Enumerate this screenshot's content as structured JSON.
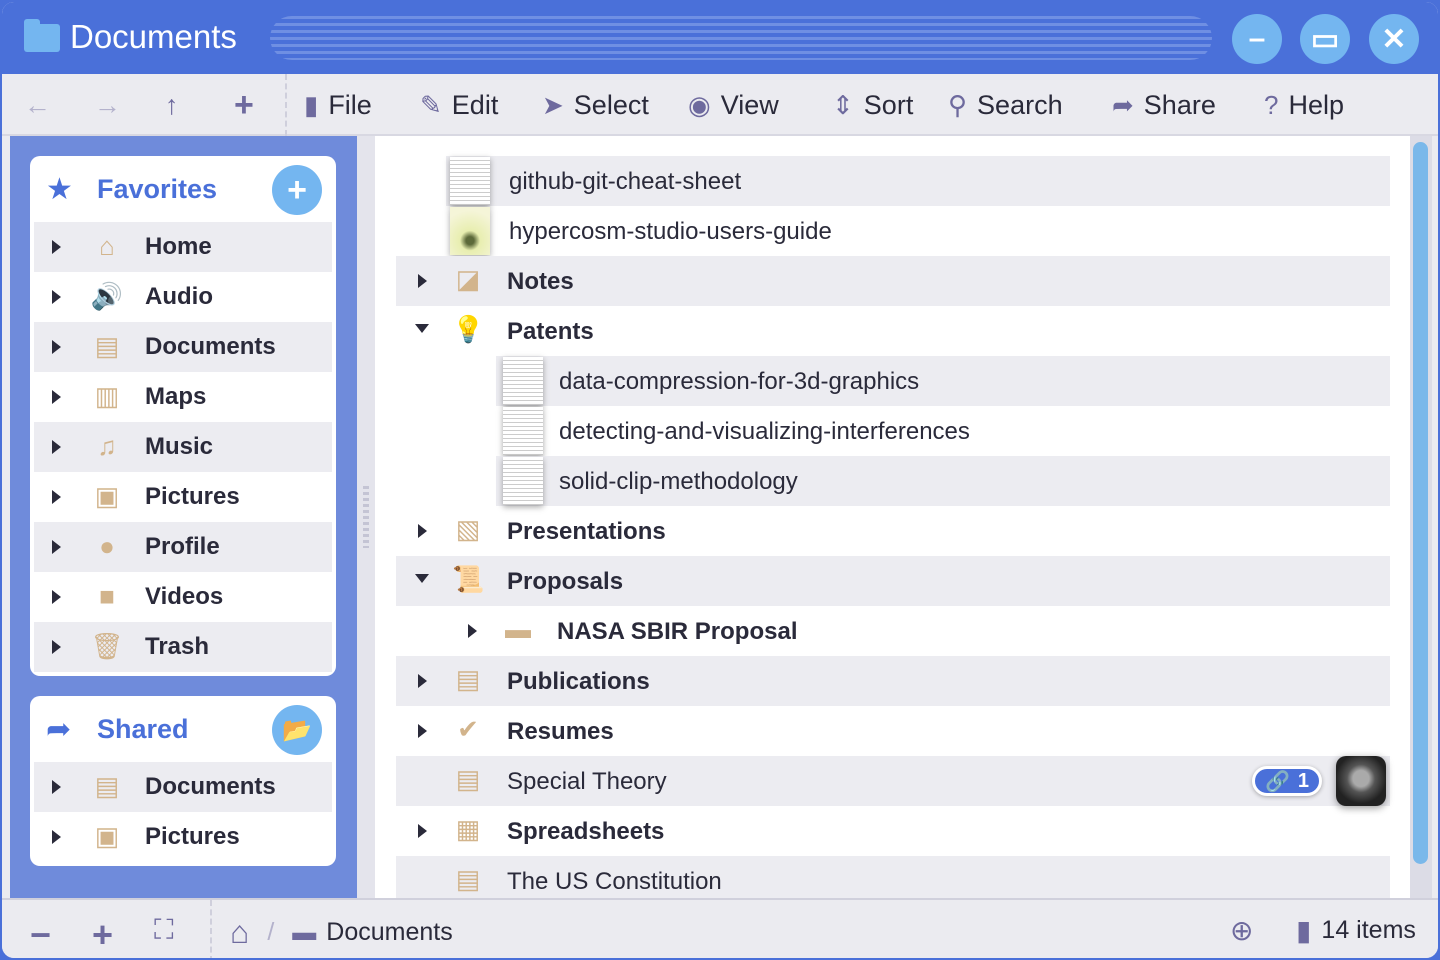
{
  "window": {
    "title": "Documents",
    "minimize": "–",
    "maximize": "▭",
    "close": "✕"
  },
  "toolbar": {
    "nav": [
      "←",
      "→",
      "↑",
      "+"
    ],
    "menus": [
      {
        "icon": "file-icon",
        "glyph": "▮",
        "label": "File"
      },
      {
        "icon": "pencil-icon",
        "glyph": "✎",
        "label": "Edit"
      },
      {
        "icon": "cursor-icon",
        "glyph": "➤",
        "label": "Select"
      },
      {
        "icon": "eye-icon",
        "glyph": "◉",
        "label": "View"
      },
      {
        "icon": "sort-icon",
        "glyph": "⇕",
        "label": "Sort"
      },
      {
        "icon": "search-icon",
        "glyph": "⚲",
        "label": "Search"
      },
      {
        "icon": "share-icon",
        "glyph": "➦",
        "label": "Share"
      },
      {
        "icon": "help-icon",
        "glyph": "?",
        "label": "Help"
      }
    ]
  },
  "sidebar": {
    "favorites": {
      "title": "Favorites",
      "items": [
        {
          "label": "Home",
          "icon": "home-icon",
          "glyph": "⌂"
        },
        {
          "label": "Audio",
          "icon": "speaker-icon",
          "glyph": "🔊"
        },
        {
          "label": "Documents",
          "icon": "document-icon",
          "glyph": "▤"
        },
        {
          "label": "Maps",
          "icon": "map-icon",
          "glyph": "▥"
        },
        {
          "label": "Music",
          "icon": "music-icon",
          "glyph": "♫"
        },
        {
          "label": "Pictures",
          "icon": "picture-icon",
          "glyph": "▣"
        },
        {
          "label": "Profile",
          "icon": "user-icon",
          "glyph": "●"
        },
        {
          "label": "Videos",
          "icon": "video-icon",
          "glyph": "■"
        },
        {
          "label": "Trash",
          "icon": "trash-icon",
          "glyph": "🗑"
        }
      ]
    },
    "shared": {
      "title": "Shared",
      "items": [
        {
          "label": "Documents",
          "icon": "document-icon",
          "glyph": "▤"
        },
        {
          "label": "Pictures",
          "icon": "picture-icon",
          "glyph": "▣"
        }
      ]
    }
  },
  "files": [
    {
      "label": "github-git-cheat-sheet",
      "level": 1,
      "thumb": "doc",
      "bold": false
    },
    {
      "label": "hypercosm-studio-users-guide",
      "level": 1,
      "thumb": "yellow",
      "bold": false
    },
    {
      "label": "Notes",
      "level": 0,
      "toggle": "closed",
      "icon": "note-icon",
      "glyph": "◪",
      "bold": true
    },
    {
      "label": "Patents",
      "level": 0,
      "toggle": "open",
      "icon": "lightbulb-icon",
      "glyph": "💡",
      "bold": true
    },
    {
      "label": "data-compression-for-3d-graphics",
      "level": 2,
      "thumb": "doc",
      "bold": false
    },
    {
      "label": "detecting-and-visualizing-interferences",
      "level": 2,
      "thumb": "doc",
      "bold": false
    },
    {
      "label": "solid-clip-methodology",
      "level": 2,
      "thumb": "doc",
      "bold": false
    },
    {
      "label": "Presentations",
      "level": 0,
      "toggle": "closed",
      "icon": "presentation-icon",
      "glyph": "▧",
      "bold": true
    },
    {
      "label": "Proposals",
      "level": 0,
      "toggle": "open",
      "icon": "scroll-icon",
      "glyph": "📜",
      "bold": true
    },
    {
      "label": "NASA SBIR Proposal",
      "level": 1,
      "toggle": "closed",
      "icon": "folder-icon",
      "glyph": "▬",
      "bold": true
    },
    {
      "label": "Publications",
      "level": 0,
      "toggle": "closed",
      "icon": "book-icon",
      "glyph": "▤",
      "bold": true
    },
    {
      "label": "Resumes",
      "level": 0,
      "toggle": "closed",
      "icon": "check-icon",
      "glyph": "✔",
      "bold": true
    },
    {
      "label": "Special Theory",
      "level": 0,
      "icon": "document-icon",
      "glyph": "▤",
      "bold": false,
      "link_count": "1",
      "shared": true
    },
    {
      "label": "Spreadsheets",
      "level": 0,
      "toggle": "closed",
      "icon": "calculator-icon",
      "glyph": "▦",
      "bold": true
    },
    {
      "label": "The US Constitution",
      "level": 0,
      "icon": "document-icon",
      "glyph": "▤",
      "bold": false
    }
  ],
  "status": {
    "zoom_out": "−",
    "zoom_in": "+",
    "fullscreen": "⛶",
    "home": "⌂",
    "separator": "/",
    "path": "Documents",
    "count": "14 items"
  },
  "colors": {
    "accent": "#4a70d9",
    "light_accent": "#74b6f0",
    "icon_tan": "#d2b48c"
  }
}
